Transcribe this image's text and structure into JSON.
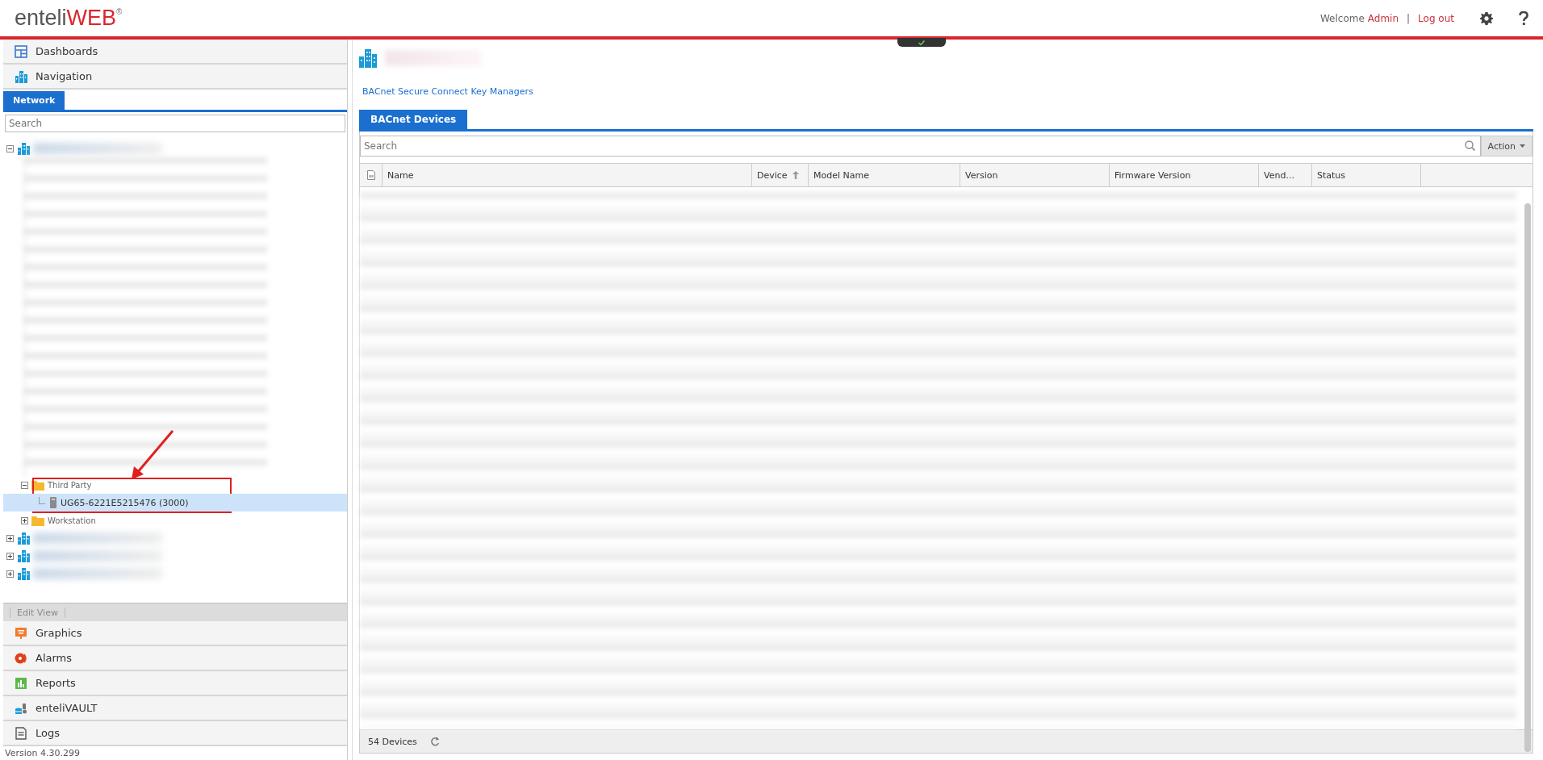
{
  "header": {
    "logo": {
      "brand": "enteli",
      "accent": "WEB",
      "mark": "®"
    },
    "welcome": "Welcome",
    "user": "Admin",
    "separator": "|",
    "logout": "Log out"
  },
  "sidebar": {
    "top_items": [
      {
        "label": "Dashboards",
        "kind": "dashboard"
      },
      {
        "label": "Navigation",
        "kind": "building"
      }
    ],
    "tabs": [
      {
        "label": "Network",
        "selected": true
      }
    ],
    "search": {
      "placeholder": "Search"
    },
    "tree": [
      {
        "kind": "building",
        "expanded": true,
        "selected": false,
        "children": [
          {
            "kind": "blurred",
            "selected": false
          },
          {
            "kind": "folder",
            "label": "Third Party",
            "expanded": true,
            "selected": false,
            "children": [
              {
                "kind": "device",
                "label": "UG65-6221E5215476 (3000)",
                "selected": true
              }
            ]
          },
          {
            "kind": "folder",
            "label": "Workstation",
            "expanded": false,
            "selected": false
          }
        ]
      },
      {
        "kind": "building",
        "expanded": false,
        "selected": false
      },
      {
        "kind": "building",
        "expanded": false,
        "selected": false
      },
      {
        "kind": "building",
        "expanded": false,
        "selected": false
      }
    ],
    "edit_view": {
      "label": "Edit View",
      "disabled": true
    },
    "bottom_items": [
      {
        "label": "Graphics",
        "kind": "graphics"
      },
      {
        "label": "Alarms",
        "kind": "alarm"
      },
      {
        "label": "Reports",
        "kind": "report"
      },
      {
        "label": "enteliVAULT",
        "kind": "vault"
      },
      {
        "label": "Logs",
        "kind": "log"
      }
    ],
    "version": "Version 4.30.299"
  },
  "main": {
    "link": "BACnet Secure Connect Key Managers",
    "tabs": [
      {
        "label": "BACnet Devices",
        "selected": true
      }
    ],
    "search": {
      "placeholder": "Search"
    },
    "action": "Action",
    "table": {
      "columns": [
        {
          "label": "Name",
          "sorted": false
        },
        {
          "label": "Device",
          "sorted": true
        },
        {
          "label": "Model Name",
          "sorted": false
        },
        {
          "label": "Version",
          "sorted": false
        },
        {
          "label": "Firmware Version",
          "sorted": false
        },
        {
          "label": "Vend...",
          "sorted": false
        },
        {
          "label": "Status",
          "sorted": false
        }
      ],
      "count": "54 Devices"
    }
  }
}
